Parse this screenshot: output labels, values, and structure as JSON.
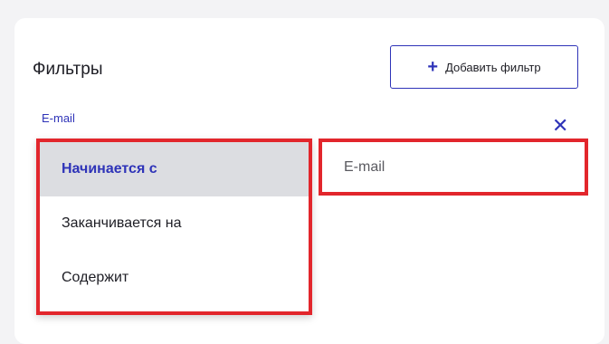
{
  "filters": {
    "title": "Фильтры",
    "add_filter_label": "Добавить фильтр",
    "add_filter_icon": "+",
    "field_label": "E-mail",
    "remove_icon": "✕",
    "dropdown_options": [
      {
        "label": "Начинается с",
        "selected": true
      },
      {
        "label": "Заканчивается на",
        "selected": false
      },
      {
        "label": "Содержит",
        "selected": false
      }
    ],
    "email_input_value": "E-mail"
  },
  "colors": {
    "accent": "#2e33b8",
    "highlight_border": "#e2262c",
    "selected_option_bg": "#dcdde1"
  }
}
